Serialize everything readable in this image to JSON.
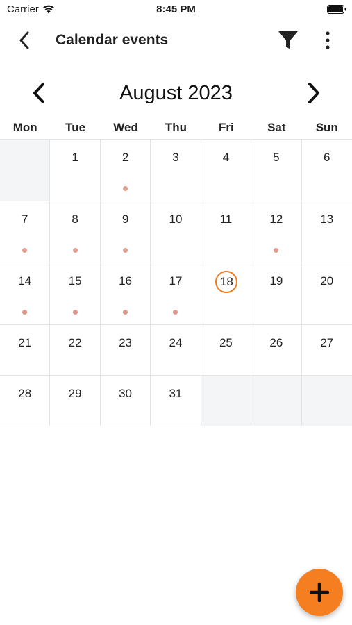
{
  "status_bar": {
    "carrier": "Carrier",
    "time": "8:45 PM"
  },
  "nav": {
    "title": "Calendar events"
  },
  "calendar": {
    "month_title": "August 2023",
    "weekdays": [
      "Mon",
      "Tue",
      "Wed",
      "Thu",
      "Fri",
      "Sat",
      "Sun"
    ],
    "today": 18,
    "today_color": "#f07a1e",
    "event_dot_color": "#e09a8e",
    "event_days": [
      2,
      7,
      8,
      9,
      12,
      14,
      15,
      16,
      17
    ],
    "weeks": [
      [
        "",
        "1",
        "2",
        "3",
        "4",
        "5",
        "6"
      ],
      [
        "7",
        "8",
        "9",
        "10",
        "11",
        "12",
        "13"
      ],
      [
        "14",
        "15",
        "16",
        "17",
        "18",
        "19",
        "20"
      ],
      [
        "21",
        "22",
        "23",
        "24",
        "25",
        "26",
        "27"
      ],
      [
        "28",
        "29",
        "30",
        "31",
        "",
        "",
        ""
      ]
    ]
  },
  "fab": {
    "icon": "plus-icon",
    "color": "#f57e20"
  }
}
